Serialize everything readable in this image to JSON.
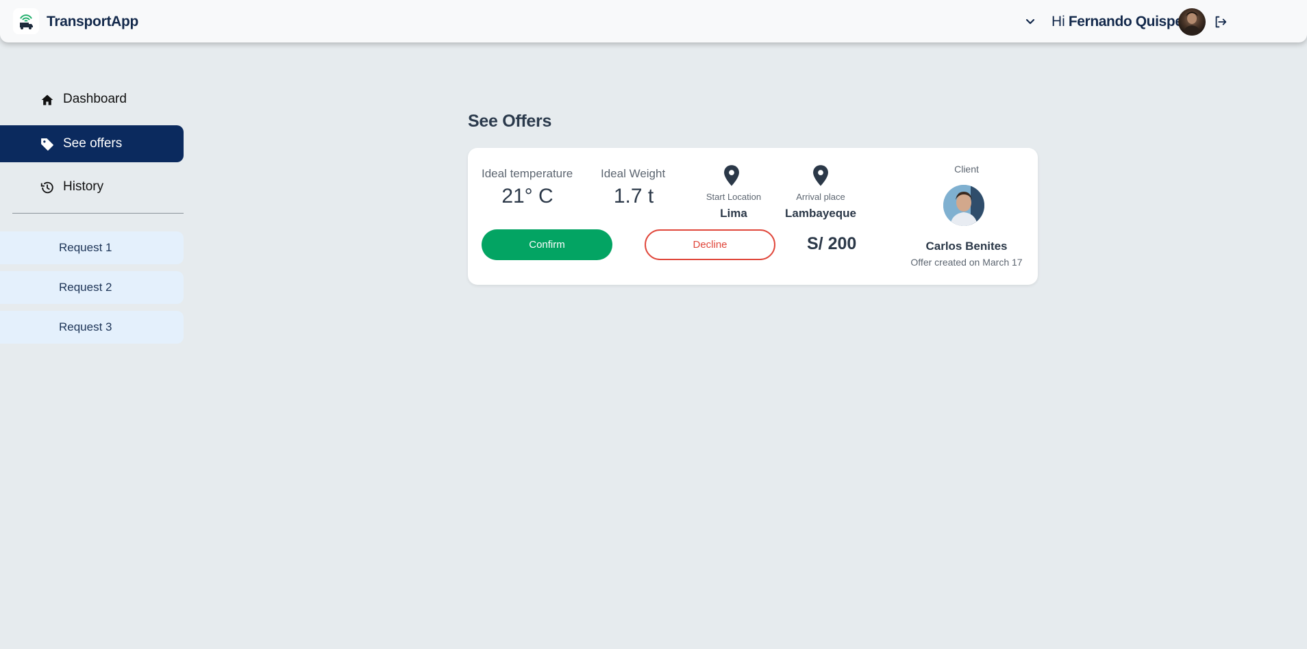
{
  "app": {
    "brand": "TransportApp",
    "greeting_prefix": "Hi",
    "user_name": "Fernando Quispe"
  },
  "sidebar": {
    "nav": [
      {
        "label": "Dashboard",
        "icon": "home-icon"
      },
      {
        "label": "See offers",
        "icon": "tag-icon",
        "active": true
      },
      {
        "label": "History",
        "icon": "history-icon"
      }
    ],
    "requests": [
      {
        "label": "Request 1"
      },
      {
        "label": "Request 2"
      },
      {
        "label": "Request 3"
      }
    ]
  },
  "main": {
    "title": "See Offers",
    "offer": {
      "temperature_label": "Ideal temperature",
      "temperature_value": "21° C",
      "weight_label": "Ideal Weight",
      "weight_value": "1.7 t",
      "start_label": "Start Location",
      "start_value": "Lima",
      "arrival_label": "Arrival place",
      "arrival_value": "Lambayeque",
      "confirm_label": "Confirm",
      "decline_label": "Decline",
      "price": "S/ 200",
      "client_label": "Client",
      "client_name": "Carlos Benites",
      "created_text": "Offer created on March 17"
    }
  },
  "colors": {
    "page_bg": "#e6ebee",
    "navy_active": "#0b2a5e",
    "confirm_green": "#03a463",
    "decline_red": "#e0463a",
    "request_bg": "#e4f0fc"
  }
}
